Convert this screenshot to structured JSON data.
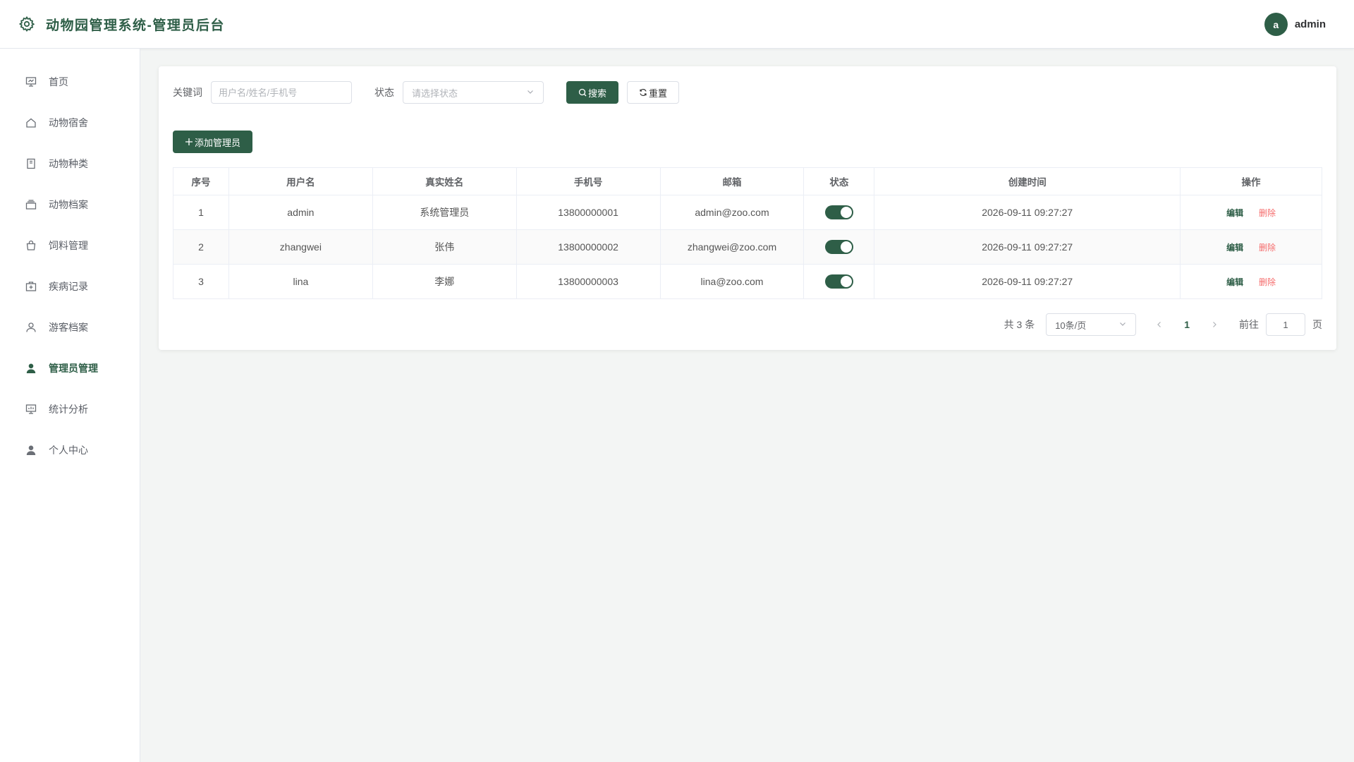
{
  "header": {
    "title": "动物园管理系统-管理员后台",
    "avatar_letter": "a",
    "username": "admin",
    "brand_color": "#2e5e47"
  },
  "sidebar": {
    "items": [
      {
        "label": "首页",
        "icon": "dashboard-icon",
        "active": false
      },
      {
        "label": "动物宿舍",
        "icon": "house-icon",
        "active": false
      },
      {
        "label": "动物种类",
        "icon": "notebook-icon",
        "active": false
      },
      {
        "label": "动物档案",
        "icon": "archive-icon",
        "active": false
      },
      {
        "label": "饲料管理",
        "icon": "bag-icon",
        "active": false
      },
      {
        "label": "疾病记录",
        "icon": "first-aid-icon",
        "active": false
      },
      {
        "label": "游客档案",
        "icon": "user-icon",
        "active": false
      },
      {
        "label": "管理员管理",
        "icon": "user-filled-icon",
        "active": true
      },
      {
        "label": "统计分析",
        "icon": "data-board-icon",
        "active": false
      },
      {
        "label": "个人中心",
        "icon": "user-filled-icon",
        "active": false
      }
    ]
  },
  "search": {
    "keyword_label": "关键词",
    "keyword_placeholder": "用户名/姓名/手机号",
    "status_label": "状态",
    "status_placeholder": "请选择状态",
    "search_button": "搜索",
    "reset_button": "重置"
  },
  "add_button": "添加管理员",
  "table": {
    "columns": [
      "序号",
      "用户名",
      "真实姓名",
      "手机号",
      "邮箱",
      "状态",
      "创建时间",
      "操作"
    ],
    "rows": [
      {
        "index": "1",
        "username": "admin",
        "realname": "系统管理员",
        "phone": "13800000001",
        "email": "admin@zoo.com",
        "enabled": true,
        "created": "2026-09-11 09:27:27"
      },
      {
        "index": "2",
        "username": "zhangwei",
        "realname": "张伟",
        "phone": "13800000002",
        "email": "zhangwei@zoo.com",
        "enabled": true,
        "created": "2026-09-11 09:27:27"
      },
      {
        "index": "3",
        "username": "lina",
        "realname": "李娜",
        "phone": "13800000003",
        "email": "lina@zoo.com",
        "enabled": true,
        "created": "2026-09-11 09:27:27"
      }
    ],
    "edit_label": "编辑",
    "delete_label": "删除"
  },
  "pagination": {
    "total_text": "共 3 条",
    "page_size": "10条/页",
    "current_page": "1",
    "goto_label": "前往",
    "goto_value": "1",
    "page_suffix": "页"
  }
}
